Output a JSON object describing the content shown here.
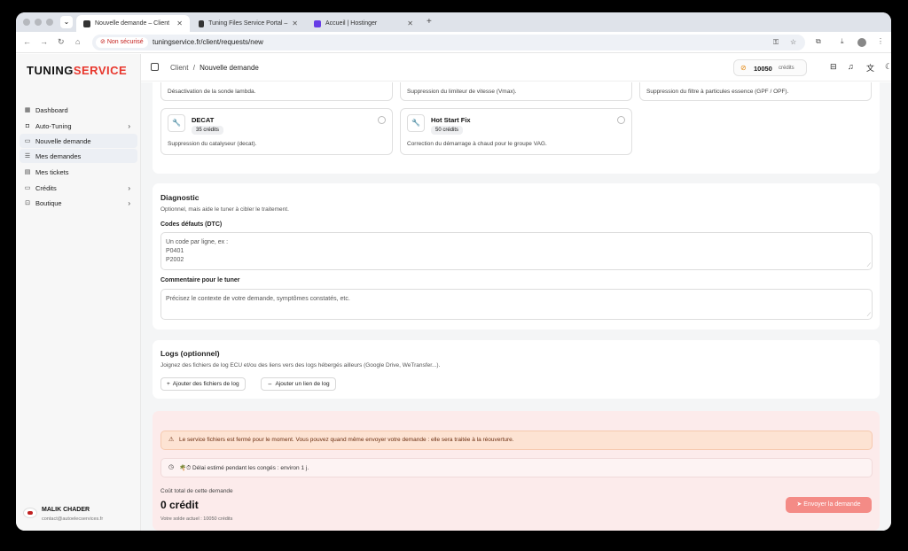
{
  "browser": {
    "tabs": [
      {
        "label": "Nouvelle demande – Client",
        "active": true
      },
      {
        "label": "Tuning Files Service Portal –",
        "active": false
      },
      {
        "label": "Accueil | Hostinger",
        "active": false
      }
    ],
    "security_label": "Non sécurisé",
    "url": "tuningservice.fr/client/requests/new"
  },
  "sidebar": {
    "logo_part1": "TUNING",
    "logo_part2": "SERVICE",
    "items": [
      {
        "label": "Dashboard",
        "icon": "dashboard-icon"
      },
      {
        "label": "Auto-Tuning",
        "icon": "chip-icon",
        "has_chevron": true
      },
      {
        "label": "Nouvelle demande",
        "icon": "document-icon",
        "selected": true
      },
      {
        "label": "Mes demandes",
        "icon": "list-icon",
        "selected": true
      },
      {
        "label": "Mes tickets",
        "icon": "ticket-icon"
      },
      {
        "label": "Crédits",
        "icon": "card-icon",
        "has_chevron": true
      },
      {
        "label": "Boutique",
        "icon": "shop-icon",
        "has_chevron": true
      }
    ],
    "user": {
      "name": "MALIK CHADER",
      "email": "contact@autoelecservices.fr"
    }
  },
  "header": {
    "breadcrumb_root": "Client",
    "breadcrumb_sep": "/",
    "breadcrumb_current": "Nouvelle demande",
    "credits_value": "10050",
    "credits_unit": "crédits"
  },
  "options": {
    "partial_descs": [
      "Désactivation de la sonde lambda.",
      "Suppression du limiteur de vitesse (Vmax).",
      "Suppression du filtre à particules essence (GPF / OPF)."
    ],
    "cards": [
      {
        "title": "DECAT",
        "badge": "35 crédits",
        "desc": "Suppression du catalyseur (decat)."
      },
      {
        "title": "Hot Start Fix",
        "badge": "50 crédits",
        "desc": "Correction du démarrage à chaud pour le groupe VAG."
      }
    ]
  },
  "diagnostic": {
    "title": "Diagnostic",
    "subtitle": "Optionnel, mais aide le tuner à cibler le traitement.",
    "dtc_label": "Codes défauts (DTC)",
    "dtc_placeholder": "Un code par ligne, ex :\nP0401\nP2002",
    "comment_label": "Commentaire pour le tuner",
    "comment_placeholder": "Précisez le contexte de votre demande, symptômes constatés, etc."
  },
  "logs": {
    "title": "Logs (optionnel)",
    "subtitle": "Joignez des fichiers de log ECU et/ou des liens vers des logs hébergés ailleurs (Google Drive, WeTransfer...).",
    "add_files": "Ajouter des fichiers de log",
    "add_link": "Ajouter un lien de log"
  },
  "submit": {
    "warning": "Le service fichiers est fermé pour le moment. Vous pouvez quand même envoyer votre demande : elle sera traitée à la réouverture.",
    "delay": "🌴⏱ Délai estimé pendant les congés : environ 1 j.",
    "cost_label": "Coût total de cette demande",
    "cost_value": "0 crédit",
    "balance": "Votre solde actuel : 10050 crédits",
    "send": "Envoyer la demande"
  },
  "colors": {
    "brand_red": "#e8362c",
    "send_button": "#f48b86",
    "warning_bg": "#fde3d3",
    "submit_card_bg": "#fcebeb"
  }
}
